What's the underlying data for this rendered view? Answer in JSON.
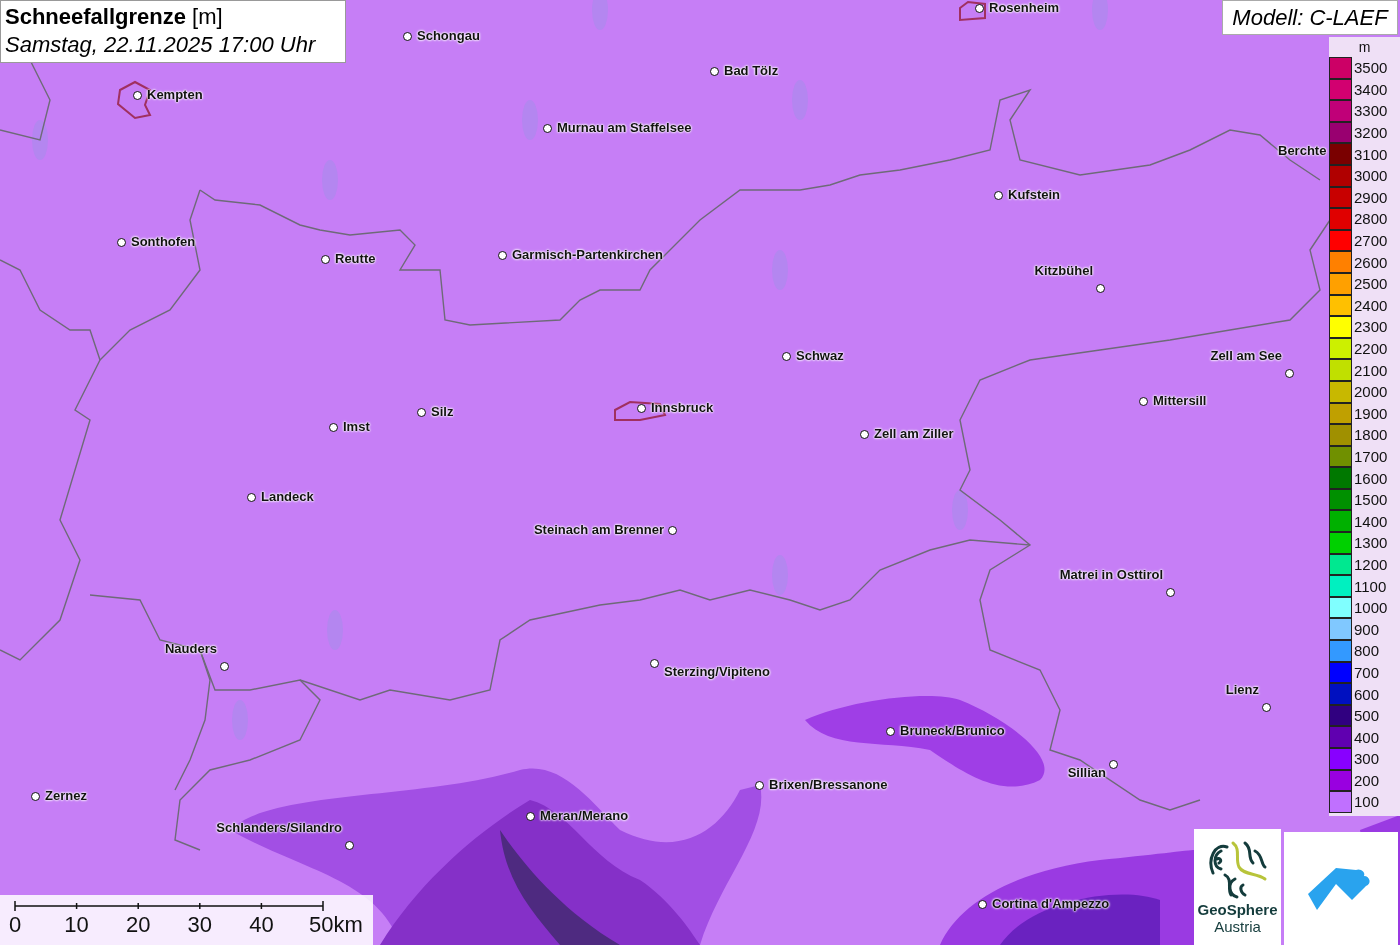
{
  "title": {
    "heading": "**Schneefallgrenze** [m]",
    "subtitle": "Samstag, 22.11.2025 17:00 Uhr"
  },
  "model": "Modell: C-LAEF",
  "cities": [
    {
      "name": "Rosenheim"
    },
    {
      "name": "Schongau"
    },
    {
      "name": "Bad Tölz"
    },
    {
      "name": "Kempten"
    },
    {
      "name": "Murnau am Staffelsee"
    },
    {
      "name": "Berchte"
    },
    {
      "name": "Kufstein"
    },
    {
      "name": "Sonthofen"
    },
    {
      "name": "Reutte"
    },
    {
      "name": "Garmisch-Partenkirchen"
    },
    {
      "name": "Kitzbühel"
    },
    {
      "name": "Schwaz"
    },
    {
      "name": "Zell am See"
    },
    {
      "name": "Mittersill"
    },
    {
      "name": "Silz"
    },
    {
      "name": "Innsbruck"
    },
    {
      "name": "Imst"
    },
    {
      "name": "Zell am Ziller"
    },
    {
      "name": "Landeck"
    },
    {
      "name": "Steinach am Brenner"
    },
    {
      "name": "Matrei in Osttirol"
    },
    {
      "name": "Nauders"
    },
    {
      "name": "Sterzing/Vipiteno"
    },
    {
      "name": "Lienz"
    },
    {
      "name": "Bruneck/Brunico"
    },
    {
      "name": "Sillian"
    },
    {
      "name": "Brixen/Bressanone"
    },
    {
      "name": "Zernez"
    },
    {
      "name": "Meran/Merano"
    },
    {
      "name": "Schlanders/Silandro"
    },
    {
      "name": "Cortina d'Ampezzo"
    }
  ],
  "legend": {
    "unit": "m",
    "steps": [
      {
        "label": "3500",
        "color": "#cc0066"
      },
      {
        "label": "3400",
        "color": "#d20070"
      },
      {
        "label": "3300",
        "color": "#c00078"
      },
      {
        "label": "3200",
        "color": "#990070"
      },
      {
        "label": "3100",
        "color": "#7a0000"
      },
      {
        "label": "3000",
        "color": "#b00000"
      },
      {
        "label": "2900",
        "color": "#c80000"
      },
      {
        "label": "2800",
        "color": "#e00000"
      },
      {
        "label": "2700",
        "color": "#ff0000"
      },
      {
        "label": "2600",
        "color": "#ff8000"
      },
      {
        "label": "2500",
        "color": "#ffa000"
      },
      {
        "label": "2400",
        "color": "#ffc000"
      },
      {
        "label": "2300",
        "color": "#ffff00"
      },
      {
        "label": "2200",
        "color": "#ccf000"
      },
      {
        "label": "2100",
        "color": "#c0e000"
      },
      {
        "label": "2000",
        "color": "#c8b800"
      },
      {
        "label": "1900",
        "color": "#c0a000"
      },
      {
        "label": "1800",
        "color": "#a09000"
      },
      {
        "label": "1700",
        "color": "#709000"
      },
      {
        "label": "1600",
        "color": "#007800"
      },
      {
        "label": "1500",
        "color": "#009000"
      },
      {
        "label": "1400",
        "color": "#00b000"
      },
      {
        "label": "1300",
        "color": "#00d000"
      },
      {
        "label": "1200",
        "color": "#00e890"
      },
      {
        "label": "1100",
        "color": "#00f0c0"
      },
      {
        "label": "1000",
        "color": "#80ffff"
      },
      {
        "label": "900",
        "color": "#80c8ff"
      },
      {
        "label": "800",
        "color": "#3399ff"
      },
      {
        "label": "700",
        "color": "#0000ff"
      },
      {
        "label": "600",
        "color": "#0010c0"
      },
      {
        "label": "500",
        "color": "#300080"
      },
      {
        "label": "400",
        "color": "#6000b0"
      },
      {
        "label": "300",
        "color": "#8800ff"
      },
      {
        "label": "200",
        "color": "#9900e0"
      },
      {
        "label": "100",
        "color": "#c070ff"
      }
    ]
  },
  "scale": [
    "0",
    "10",
    "20",
    "30",
    "40",
    "50km"
  ],
  "logo": {
    "line1": "GeoSphere",
    "line2": "Austria"
  }
}
